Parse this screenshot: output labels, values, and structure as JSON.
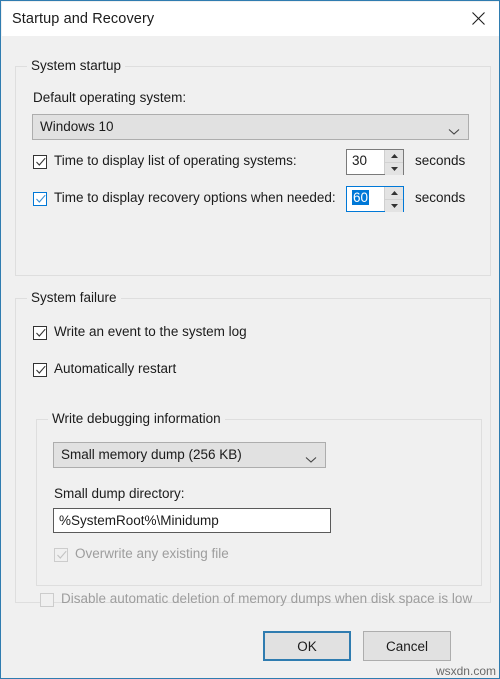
{
  "window": {
    "title": "Startup and Recovery",
    "close_icon": "close-icon",
    "accent_color": "#2f7cb0",
    "background_color": "#f0f0f0"
  },
  "system_startup": {
    "group_label": "System startup",
    "default_os_label": "Default operating system:",
    "default_os_value": "Windows 10",
    "default_os_chevron": "chevron-down-icon",
    "timeout_os": {
      "checkbox_label": "Time to display list of operating systems:",
      "checked": true,
      "value": "30",
      "units": "seconds",
      "focused": false,
      "selected": false
    },
    "timeout_recovery": {
      "checkbox_label": "Time to display recovery options when needed:",
      "checked": true,
      "value": "60",
      "units": "seconds",
      "focused": true,
      "selected": true
    }
  },
  "system_failure": {
    "group_label": "System failure",
    "write_event_label": "Write an event to the system log",
    "write_event_checked": true,
    "auto_restart_label": "Automatically restart",
    "auto_restart_checked": true,
    "debug_group_label": "Write debugging information",
    "dump_type_value": "Small memory dump (256 KB)",
    "dump_type_chevron": "chevron-down-icon",
    "dump_dir_label": "Small dump directory:",
    "dump_dir_value": "%SystemRoot%\\Minidump",
    "overwrite_label": "Overwrite any existing file",
    "overwrite_checked": true,
    "overwrite_disabled": true,
    "disable_deletion_label": "Disable automatic deletion of memory dumps when disk space is low",
    "disable_deletion_checked": false,
    "disable_deletion_disabled": true
  },
  "footer": {
    "ok_label": "OK",
    "cancel_label": "Cancel",
    "watermark": "wsxdn.com"
  }
}
